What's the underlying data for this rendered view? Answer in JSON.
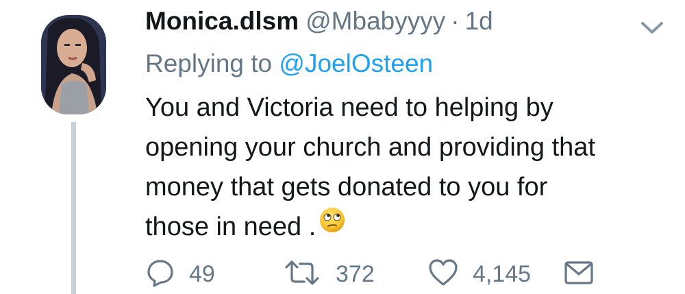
{
  "tweet": {
    "author": {
      "display_name": "Monica.dlsm",
      "handle": "@Mbabyyyy"
    },
    "separator": "·",
    "time": "1d",
    "reply": {
      "prefix": "Replying to",
      "mention": "@JoelOsteen"
    },
    "text_lines": [
      "You and Victoria need to helping by",
      "opening your church and providing that",
      "money that gets donated to you for",
      "those in  need ."
    ],
    "emoji": "face-with-rolling-eyes-emoji",
    "actions": {
      "reply_count": "49",
      "retweet_count": "372",
      "like_count": "4,145"
    },
    "icons": {
      "reply": "reply-icon",
      "retweet": "retweet-icon",
      "like": "heart-icon",
      "dm": "envelope-icon",
      "menu": "chevron-down-icon"
    },
    "colors": {
      "text": "#14171a",
      "secondary": "#657786",
      "link": "#1da1f2",
      "thread_line": "#c7d0d7"
    }
  }
}
